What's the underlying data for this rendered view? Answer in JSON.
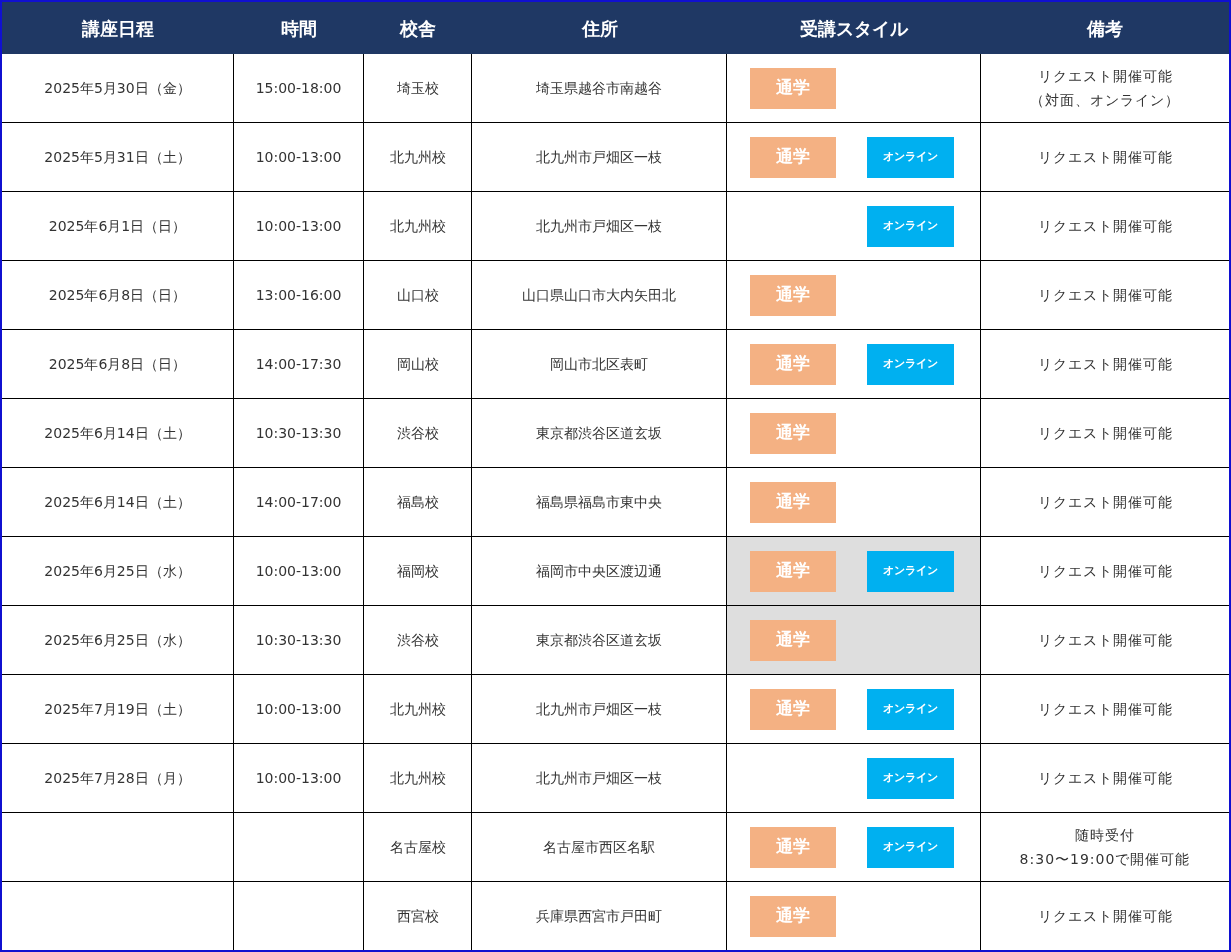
{
  "table": {
    "columns": [
      "講座日程",
      "時間",
      "校舎",
      "住所",
      "受講スタイル",
      "備考"
    ],
    "rows": [
      {
        "date": "2025年5月30日（金）",
        "time": "15:00-18:00",
        "campus": "埼玉校",
        "address": "埼玉県越谷市南越谷",
        "selected": false,
        "styles": [
          {
            "kind": "commute",
            "label": "通学"
          }
        ],
        "remarks": [
          "リクエスト開催可能",
          "（対面、オンライン）"
        ]
      },
      {
        "date": "2025年5月31日（土）",
        "time": "10:00-13:00",
        "campus": "北九州校",
        "address": "北九州市戸畑区一枝",
        "selected": false,
        "styles": [
          {
            "kind": "commute",
            "label": "通学"
          },
          {
            "kind": "online",
            "label": "オンライン"
          }
        ],
        "remarks": [
          "リクエスト開催可能"
        ]
      },
      {
        "date": "2025年6月1日（日）",
        "time": "10:00-13:00",
        "campus": "北九州校",
        "address": "北九州市戸畑区一枝",
        "selected": false,
        "styles": [
          {
            "kind": "online",
            "label": "オンライン"
          }
        ],
        "remarks": [
          "リクエスト開催可能"
        ]
      },
      {
        "date": "2025年6月8日（日）",
        "time": "13:00-16:00",
        "campus": "山口校",
        "address": "山口県山口市大内矢田北",
        "selected": false,
        "styles": [
          {
            "kind": "commute",
            "label": "通学"
          }
        ],
        "remarks": [
          "リクエスト開催可能"
        ]
      },
      {
        "date": "2025年6月8日（日）",
        "time": "14:00-17:30",
        "campus": "岡山校",
        "address": "岡山市北区表町",
        "selected": false,
        "styles": [
          {
            "kind": "commute",
            "label": "通学"
          },
          {
            "kind": "online",
            "label": "オンライン"
          }
        ],
        "remarks": [
          "リクエスト開催可能"
        ]
      },
      {
        "date": "2025年6月14日（土）",
        "time": "10:30-13:30",
        "campus": "渋谷校",
        "address": "東京都渋谷区道玄坂",
        "selected": false,
        "styles": [
          {
            "kind": "commute",
            "label": "通学"
          }
        ],
        "remarks": [
          "リクエスト開催可能"
        ]
      },
      {
        "date": "2025年6月14日（土）",
        "time": "14:00-17:00",
        "campus": "福島校",
        "address": "福島県福島市東中央",
        "selected": false,
        "styles": [
          {
            "kind": "commute",
            "label": "通学"
          }
        ],
        "remarks": [
          "リクエスト開催可能"
        ]
      },
      {
        "date": "2025年6月25日（水）",
        "time": "10:00-13:00",
        "campus": "福岡校",
        "address": "福岡市中央区渡辺通",
        "selected": true,
        "styles": [
          {
            "kind": "commute",
            "label": "通学"
          },
          {
            "kind": "online",
            "label": "オンライン"
          }
        ],
        "remarks": [
          "リクエスト開催可能"
        ]
      },
      {
        "date": "2025年6月25日（水）",
        "time": "10:30-13:30",
        "campus": "渋谷校",
        "address": "東京都渋谷区道玄坂",
        "selected": true,
        "styles": [
          {
            "kind": "commute",
            "label": "通学"
          }
        ],
        "remarks": [
          "リクエスト開催可能"
        ]
      },
      {
        "date": "2025年7月19日（土）",
        "time": "10:00-13:00",
        "campus": "北九州校",
        "address": "北九州市戸畑区一枝",
        "selected": false,
        "styles": [
          {
            "kind": "commute",
            "label": "通学"
          },
          {
            "kind": "online",
            "label": "オンライン"
          }
        ],
        "remarks": [
          "リクエスト開催可能"
        ]
      },
      {
        "date": "2025年7月28日（月）",
        "time": "10:00-13:00",
        "campus": "北九州校",
        "address": "北九州市戸畑区一枝",
        "selected": false,
        "styles": [
          {
            "kind": "online",
            "label": "オンライン"
          }
        ],
        "remarks": [
          "リクエスト開催可能"
        ]
      },
      {
        "campus": "名古屋校",
        "address": "名古屋市西区名駅",
        "selected": false,
        "styles": [
          {
            "kind": "commute",
            "label": "通学"
          },
          {
            "kind": "online",
            "label": "オンライン"
          }
        ],
        "remarks": [
          "随時受付",
          "8:30〜19:00で開催可能"
        ]
      },
      {
        "campus": "西宮校",
        "address": "兵庫県西宮市戸田町",
        "selected": false,
        "styles": [
          {
            "kind": "commute",
            "label": "通学"
          }
        ],
        "remarks": [
          "リクエスト開催可能"
        ]
      }
    ]
  }
}
